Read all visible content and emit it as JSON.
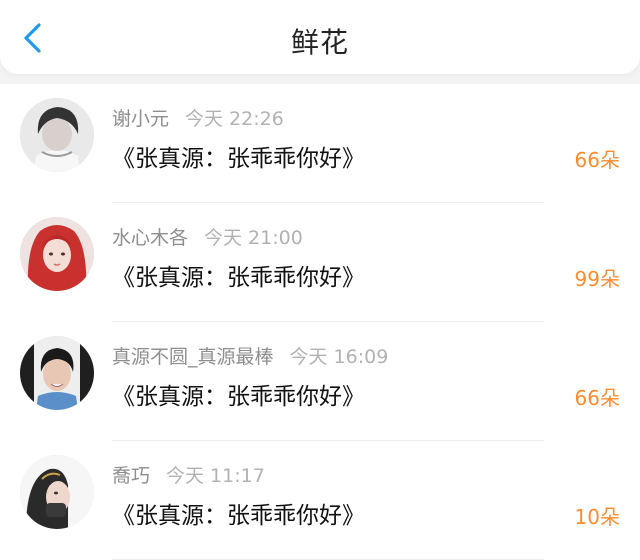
{
  "header": {
    "title": "鲜花",
    "back_icon": "chevron-left-icon",
    "accent_color": "#1e9bf0"
  },
  "list": {
    "count_color": "#ff8c2e",
    "rows": [
      {
        "user": "谢小元",
        "time": "今天 22:26",
        "item": "《张真源：张乖乖你好》",
        "count": "66朵"
      },
      {
        "user": "水心木各",
        "time": "今天 21:00",
        "item": "《张真源：张乖乖你好》",
        "count": "99朵"
      },
      {
        "user": "真源不圆_真源最棒",
        "time": "今天 16:09",
        "item": "《张真源：张乖乖你好》",
        "count": "66朵"
      },
      {
        "user": "喬巧",
        "time": "今天 11:17",
        "item": "《张真源：张乖乖你好》",
        "count": "10朵"
      }
    ]
  }
}
